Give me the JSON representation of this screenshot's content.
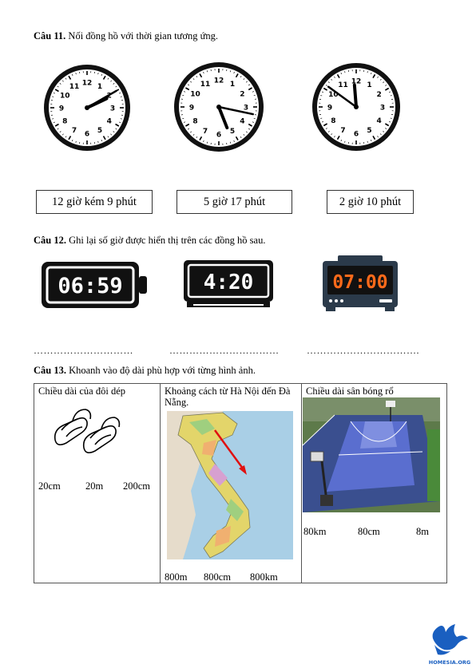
{
  "q11": {
    "label": "Câu 11.",
    "text": " Nối đồng hồ với thời gian tương ứng.",
    "clock_numbers": [
      "12",
      "1",
      "2",
      "3",
      "4",
      "5",
      "6",
      "7",
      "8",
      "9",
      "10",
      "11"
    ],
    "clocks": [
      {
        "hour": 2,
        "minute": 10
      },
      {
        "hour": 5,
        "minute": 17
      },
      {
        "hour": 11,
        "minute": 51
      }
    ],
    "answers": [
      "12 giờ kém 9 phút",
      "5 giờ 17 phút",
      "2 giờ 10 phút"
    ]
  },
  "q12": {
    "label": "Câu 12.",
    "text": " Ghi lại số giờ được hiển thị trên các đồng hồ sau.",
    "displays": [
      "06:59",
      "4:20",
      "07:00"
    ],
    "display_colors": [
      "#ffffff",
      "#ffffff",
      "#ff6a1a"
    ],
    "blanks": [
      "…………………………",
      "……………………………",
      "……………………………."
    ]
  },
  "q13": {
    "label": "Câu 13.",
    "text": " Khoanh vào độ dài phù hợp với từng hình ảnh.",
    "cells": [
      {
        "title": "Chiều dài của đôi dép",
        "options": [
          "20cm",
          "20m",
          "200cm"
        ]
      },
      {
        "title": "Khoảng cách từ Hà Nội đến Đà Nẵng.",
        "options": [
          "800m",
          "800cm",
          "800km"
        ]
      },
      {
        "title": "Chiều dài sân bóng rổ",
        "options": [
          "80km",
          "80cm",
          "8m"
        ]
      }
    ]
  },
  "logo": {
    "text": "HOMESIA.ORG",
    "color": "#1a5fc0"
  }
}
